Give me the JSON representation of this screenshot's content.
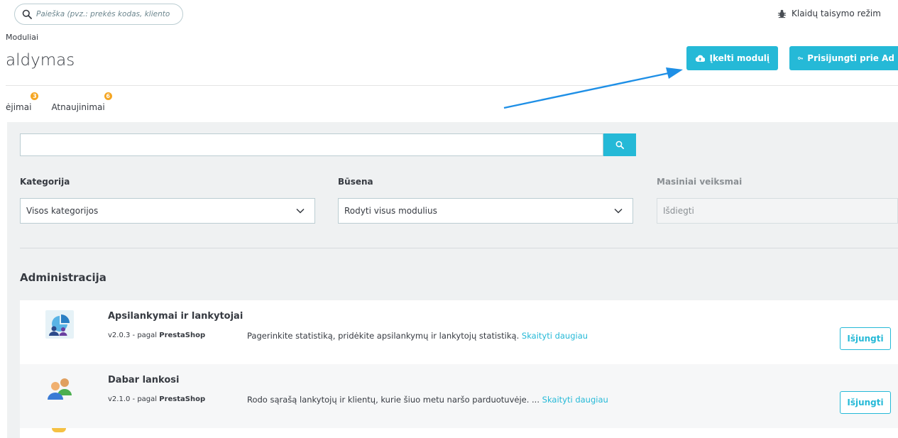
{
  "header": {
    "search_placeholder": "Paieška (pvz.: prekės kodas, kliento vara",
    "debug_label": "Klaidų taisymo režim",
    "breadcrumb": "Moduliai",
    "page_title": "aldymas",
    "upload_button": "Įkelti modulį",
    "connect_button": "Prisijungti prie Ad"
  },
  "tabs": [
    {
      "label": "ėjimai",
      "badge": "3"
    },
    {
      "label": "Atnaujinimai",
      "badge": "6"
    }
  ],
  "filters": {
    "search_value": "",
    "category_label": "Kategorija",
    "category_value": "Visos kategorijos",
    "status_label": "Būsena",
    "status_value": "Rodyti visus modulius",
    "bulk_label": "Masiniai veiksmai",
    "bulk_value": "Išdiegti"
  },
  "section_title": "Administracija",
  "modules": [
    {
      "name": "Apsilankymai ir lankytojai",
      "version": "v2.0.3 - pagal",
      "author": "PrestaShop",
      "description": "Pagerinkite statistiką, pridėkite apsilankymų ir lankytojų statistiką.",
      "read_more": "Skaityti daugiau",
      "action": "Išjungti"
    },
    {
      "name": "Dabar lankosi",
      "version": "v2.1.0 - pagal",
      "author": "PrestaShop",
      "description": "Rodo sąrašą lankytojų ir klientų, kurie šiuo metu naršo parduotuvėje. ...",
      "read_more": "Skaityti daugiau",
      "action": "Išjungti"
    }
  ],
  "colors": {
    "accent": "#25b9d7",
    "badge": "#f5a623",
    "annotation_arrow": "#1e8fe6",
    "panel_bg": "#eff1f2"
  },
  "icons": {
    "search": "search-icon",
    "debug": "bug-icon",
    "upload": "cloud-upload-icon",
    "connect": "key-icon",
    "dropdown": "chevron-down-icon"
  }
}
